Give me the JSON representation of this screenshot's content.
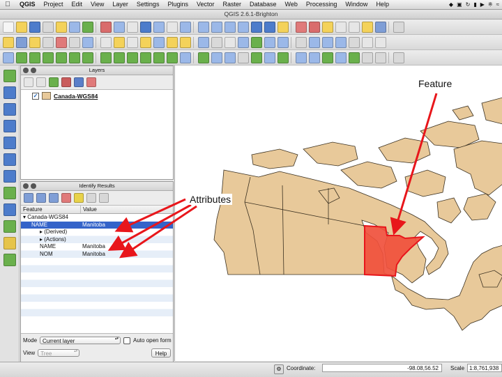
{
  "menubar": {
    "app_name": "QGIS",
    "items": [
      "Project",
      "Edit",
      "View",
      "Layer",
      "Settings",
      "Plugins",
      "Vector",
      "Raster",
      "Database",
      "Web",
      "Processing",
      "Window",
      "Help"
    ],
    "status_icons": [
      "dropbox-icon",
      "screen-icon",
      "sync-icon",
      "battery-icon",
      "volume-icon",
      "bluetooth-icon",
      "wifi-icon"
    ]
  },
  "window": {
    "title": "QGIS 2.6.1-Brighton"
  },
  "layers_panel": {
    "title": "Layers",
    "layers": [
      {
        "name": "Canada-WGS84",
        "checked": true,
        "color": "#e8c99a"
      }
    ]
  },
  "identify_panel": {
    "title": "Identify Results",
    "columns": [
      "Feature",
      "Value"
    ],
    "rows": [
      {
        "feature": "Canada-WGS84",
        "value": "",
        "indent": 0,
        "expander": "open"
      },
      {
        "feature": "NAME",
        "value": "Manitoba",
        "indent": 1,
        "expander": "",
        "selected": true
      },
      {
        "feature": "(Derived)",
        "value": "",
        "indent": 2,
        "expander": "closed"
      },
      {
        "feature": "(Actions)",
        "value": "",
        "indent": 2,
        "expander": "closed"
      },
      {
        "feature": "NAME",
        "value": "Manitoba",
        "indent": 2,
        "expander": ""
      },
      {
        "feature": "NOM",
        "value": "Manitoba",
        "indent": 2,
        "expander": ""
      }
    ],
    "mode_label": "Mode",
    "mode_value": "Current layer",
    "auto_open_label": "Auto open form",
    "view_label": "View",
    "view_value": "Tree",
    "help_label": "Help"
  },
  "annotations": {
    "feature_label": "Feature",
    "attributes_label": "Attributes"
  },
  "statusbar": {
    "coordinate_label": "Coordinate:",
    "coordinate_value": "-98.08,56.52",
    "scale_label": "Scale",
    "scale_value": "1:8,761,938"
  },
  "colors": {
    "land": "#e8c99a",
    "selected_feature": "#f0503c",
    "arrow": "#e8161b",
    "selection_row": "#3463c9"
  }
}
